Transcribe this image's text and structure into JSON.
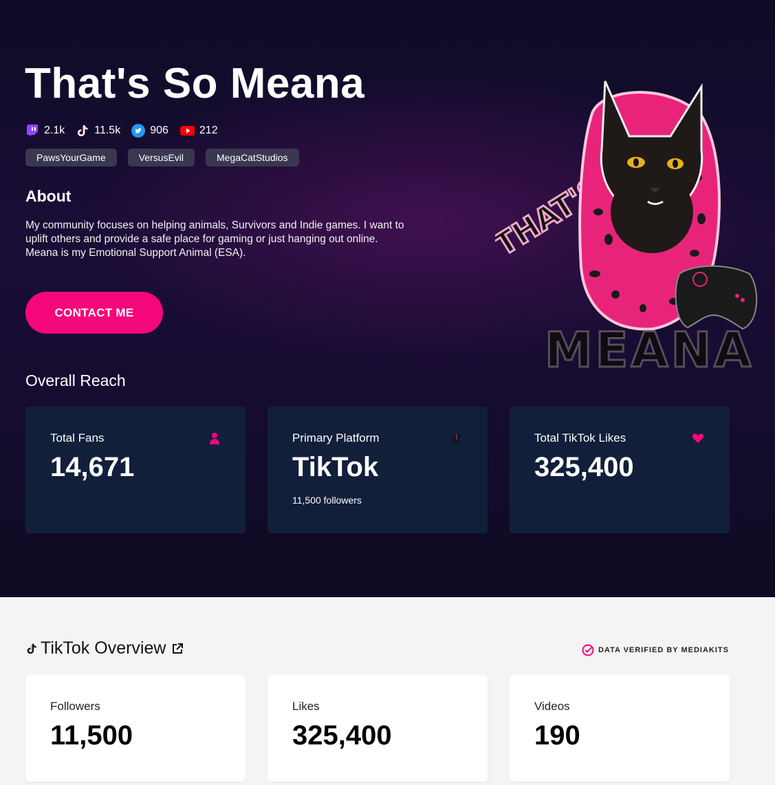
{
  "profile": {
    "name": "That's So Meana",
    "socials": [
      {
        "platform": "twitch",
        "icon": "twitch-icon",
        "count": "2.1k"
      },
      {
        "platform": "tiktok",
        "icon": "tiktok-icon",
        "count": "11.5k"
      },
      {
        "platform": "twitter",
        "icon": "twitter-icon",
        "count": "906"
      },
      {
        "platform": "youtube",
        "icon": "youtube-icon",
        "count": "212"
      }
    ],
    "tags": [
      "PawsYourGame",
      "VersusEvil",
      "MegaCatStudios"
    ],
    "about_heading": "About",
    "about_text": "My community focuses on helping animals, Survivors and Indie games. I want to uplift others and provide a safe place for gaming or just hanging out online. Meana is my Emotional Support Animal (ESA).",
    "contact_label": "CONTACT ME",
    "mascot_text": {
      "top": "THAT'S SO",
      "bottom": "MEANA"
    }
  },
  "reach": {
    "heading": "Overall Reach",
    "cards": [
      {
        "label": "Total Fans",
        "value": "14,671",
        "icon": "user-icon"
      },
      {
        "label": "Primary Platform",
        "value": "TikTok",
        "sub": "11,500 followers",
        "icon": "tiktok-icon"
      },
      {
        "label": "Total TikTok Likes",
        "value": "325,400",
        "icon": "heart-icon"
      }
    ]
  },
  "tiktok_overview": {
    "title": "TikTok Overview",
    "verified_label": "DATA VERIFIED BY MEDIAKITS",
    "cards": [
      {
        "label": "Followers",
        "value": "11,500"
      },
      {
        "label": "Likes",
        "value": "325,400"
      },
      {
        "label": "Videos",
        "value": "190"
      }
    ]
  },
  "colors": {
    "accent": "#f5087a",
    "card_dark": "#111f3a",
    "tag_bg": "#3a3750",
    "twitch": "#9146ff",
    "twitter": "#1d9bf0",
    "youtube": "#ff0000"
  }
}
